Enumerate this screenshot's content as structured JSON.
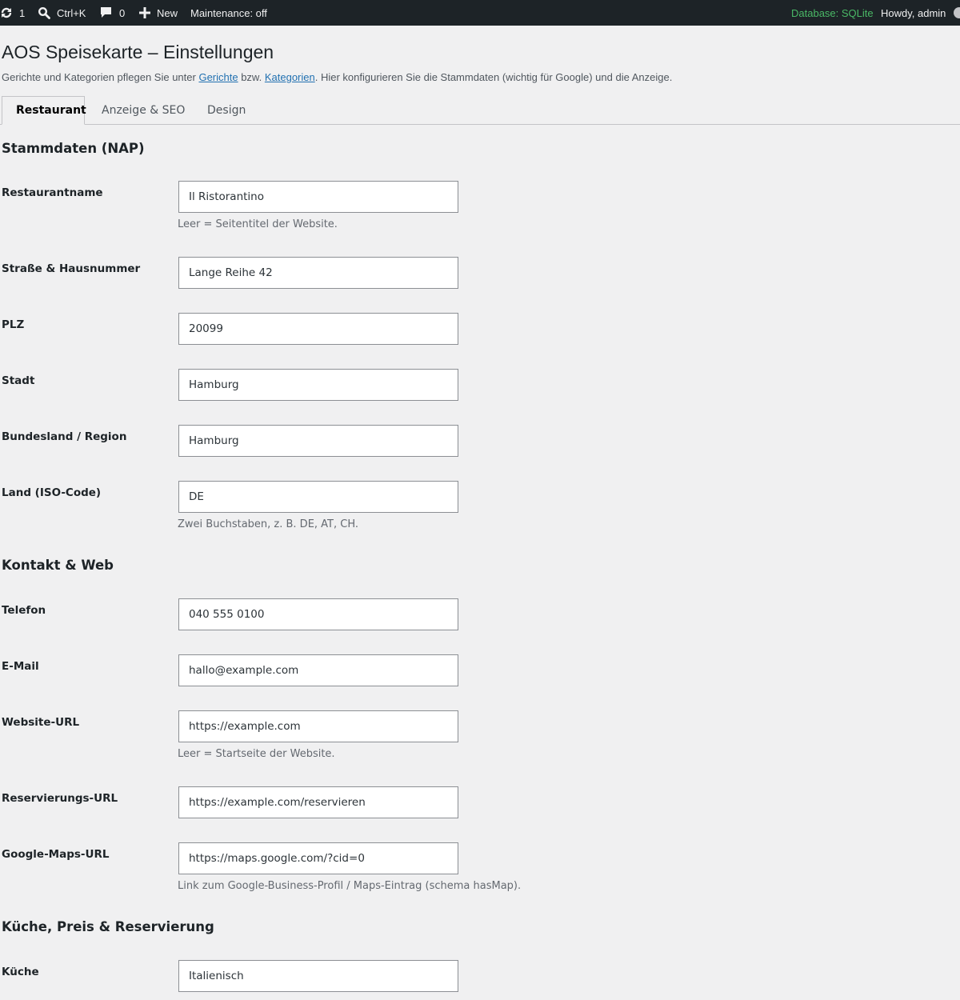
{
  "adminbar": {
    "updates_count": "1",
    "search_shortcut": "Ctrl+K",
    "comments_count": "0",
    "new_label": "New",
    "maintenance": "Maintenance: off",
    "database": "Database: SQLite",
    "howdy": "Howdy, admin"
  },
  "header": {
    "title": "AOS Speisekarte – Einstellungen",
    "intro_before": "Gerichte und Kategorien pflegen Sie unter ",
    "link_dishes": "Gerichte",
    "intro_mid": " bzw. ",
    "link_categories": "Kategorien",
    "intro_after": ". Hier konfigurieren Sie die Stammdaten (wichtig für Google) und die Anzeige."
  },
  "tabs": [
    {
      "label": "Restaurant",
      "active": true
    },
    {
      "label": "Anzeige & SEO",
      "active": false
    },
    {
      "label": "Design",
      "active": false
    }
  ],
  "sections": {
    "nap": "Stammdaten (NAP)",
    "contact": "Kontakt & Web",
    "cuisine": "Küche, Preis & Reservierung"
  },
  "fields": {
    "name": {
      "label": "Restaurantname",
      "value": "Il Ristorantino",
      "desc": "Leer = Seitentitel der Website."
    },
    "street": {
      "label": "Straße & Hausnummer",
      "value": "Lange Reihe 42"
    },
    "zip": {
      "label": "PLZ",
      "value": "20099"
    },
    "city": {
      "label": "Stadt",
      "value": "Hamburg"
    },
    "region": {
      "label": "Bundesland / Region",
      "value": "Hamburg"
    },
    "country": {
      "label": "Land (ISO-Code)",
      "value": "DE",
      "desc": "Zwei Buchstaben, z. B. DE, AT, CH."
    },
    "phone": {
      "label": "Telefon",
      "value": "040 555 0100"
    },
    "email": {
      "label": "E-Mail",
      "value": "hallo@example.com"
    },
    "website": {
      "label": "Website-URL",
      "value": "https://example.com",
      "desc": "Leer = Startseite der Website."
    },
    "reservation": {
      "label": "Reservierungs-URL",
      "value": "https://example.com/reservieren"
    },
    "maps": {
      "label": "Google-Maps-URL",
      "value": "https://maps.google.com/?cid=0",
      "desc": "Link zum Google-Business-Profil / Maps-Eintrag (schema hasMap)."
    },
    "cuisine": {
      "label": "Küche",
      "value": "Italienisch"
    }
  },
  "colors": {
    "adminbar_bg": "#1d2327",
    "database_green": "#4ab866",
    "link_blue": "#2271b1",
    "page_bg": "#f0f0f1"
  },
  "icons": {
    "updates": "refresh-icon",
    "search": "search-icon",
    "comments": "comment-icon",
    "new": "plus-icon"
  }
}
